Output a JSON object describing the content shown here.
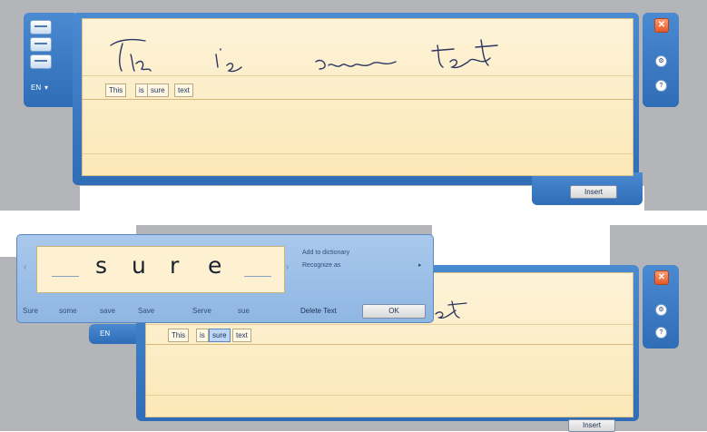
{
  "top_panel": {
    "language": "EN",
    "handwriting": [
      "This",
      "is",
      "some",
      "text"
    ],
    "recognized_words": [
      "This",
      "is",
      "sure",
      "text"
    ],
    "insert_label": "Insert",
    "close_glyph": "✕",
    "options_glyph": "⚙",
    "help_glyph": "?"
  },
  "bottom_panel": {
    "language": "EN",
    "recognized_words": [
      "This",
      "is",
      "sure",
      "text"
    ],
    "selected_word_index": 2,
    "insert_label": "Insert",
    "handwriting_fragment": "ext",
    "close_glyph": "✕",
    "options_glyph": "⚙",
    "help_glyph": "?"
  },
  "correction_popup": {
    "letters": [
      "s",
      "u",
      "r",
      "e"
    ],
    "candidates": [
      "Sure",
      "some",
      "save",
      "Save",
      "Serve",
      "sue"
    ],
    "menu": {
      "add_to_dictionary": "Add to dictionary",
      "recognize_as": "Recognize as",
      "delete_text": "Delete Text",
      "ok": "OK"
    }
  },
  "colors": {
    "frame": "#3f7fc7",
    "paper": "#fdeec9",
    "close": "#e25a2a"
  },
  "icons": [
    "menu-lines-icon",
    "close-icon",
    "gear-icon",
    "help-icon",
    "chevron-left-icon",
    "chevron-right-icon",
    "submenu-arrow-icon"
  ]
}
